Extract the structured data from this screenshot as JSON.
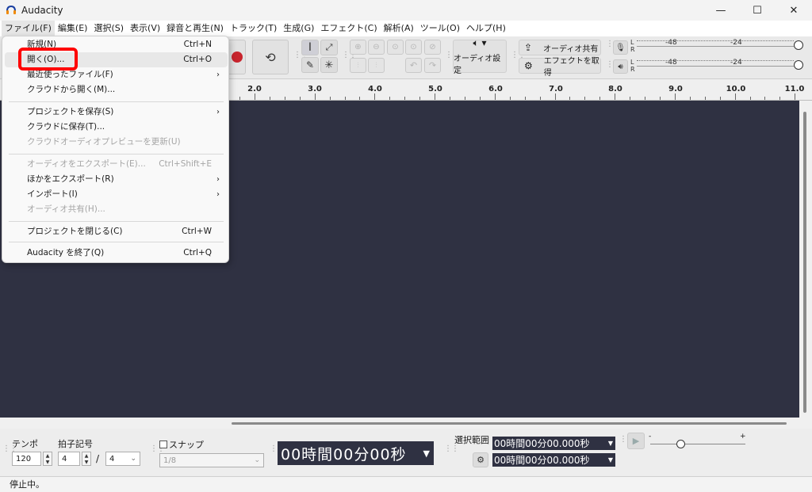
{
  "window": {
    "title": "Audacity",
    "minimize": "—",
    "maximize": "☐",
    "close": "✕"
  },
  "menubar": [
    "ファイル(F)",
    "編集(E)",
    "選択(S)",
    "表示(V)",
    "録音と再生(N)",
    "トラック(T)",
    "生成(G)",
    "エフェクト(C)",
    "解析(A)",
    "ツール(O)",
    "ヘルプ(H)"
  ],
  "toolbar": {
    "audio_setup": "オーディオ設定",
    "share_audio": "オーディオ共有",
    "get_effects": "エフェクトを取得",
    "meter_rec": {
      "l": "L",
      "r": "R",
      "mark1": "-48",
      "mark2": "-24"
    },
    "meter_play": {
      "l": "L",
      "r": "R",
      "mark1": "-48",
      "mark2": "-24"
    }
  },
  "ruler": [
    "2.0",
    "3.0",
    "4.0",
    "5.0",
    "6.0",
    "7.0",
    "8.0",
    "9.0",
    "10.0",
    "11.0"
  ],
  "file_menu": [
    {
      "label": "新規(N)",
      "shortcut": "Ctrl+N"
    },
    {
      "label": "開く(O)...",
      "shortcut": "Ctrl+O"
    },
    {
      "label": "最近使ったファイル(F)",
      "shortcut": ""
    },
    {
      "label": "クラウドから開く(M)...",
      "shortcut": ""
    },
    {
      "label": "プロジェクトを保存(S)",
      "shortcut": ""
    },
    {
      "label": "クラウドに保存(T)...",
      "shortcut": ""
    },
    {
      "label": "クラウドオーディオプレビューを更新(U)",
      "shortcut": ""
    },
    {
      "label": "オーディオをエクスポート(E)...",
      "shortcut": "Ctrl+Shift+E"
    },
    {
      "label": "ほかをエクスポート(R)",
      "shortcut": ""
    },
    {
      "label": "インポート(I)",
      "shortcut": ""
    },
    {
      "label": "オーディオ共有(H)...",
      "shortcut": ""
    },
    {
      "label": "プロジェクトを閉じる(C)",
      "shortcut": "Ctrl+W"
    },
    {
      "label": "Audacity を終了(Q)",
      "shortcut": "Ctrl+Q"
    }
  ],
  "bottom": {
    "tempo_label": "テンポ",
    "tempo_value": "120",
    "timesig_label": "拍子記号",
    "timesig_num": "4",
    "timesig_slash": "/",
    "timesig_den": "4",
    "snap_label": "スナップ",
    "snap_value": "1/8",
    "time_display": "00時間00分00秒",
    "selection_label": "選択範囲",
    "sel_start": "00時間00分00.000秒",
    "sel_end": "00時間00分00.000秒",
    "speed_minus": "-",
    "speed_plus": "+"
  },
  "status": "停止中。"
}
